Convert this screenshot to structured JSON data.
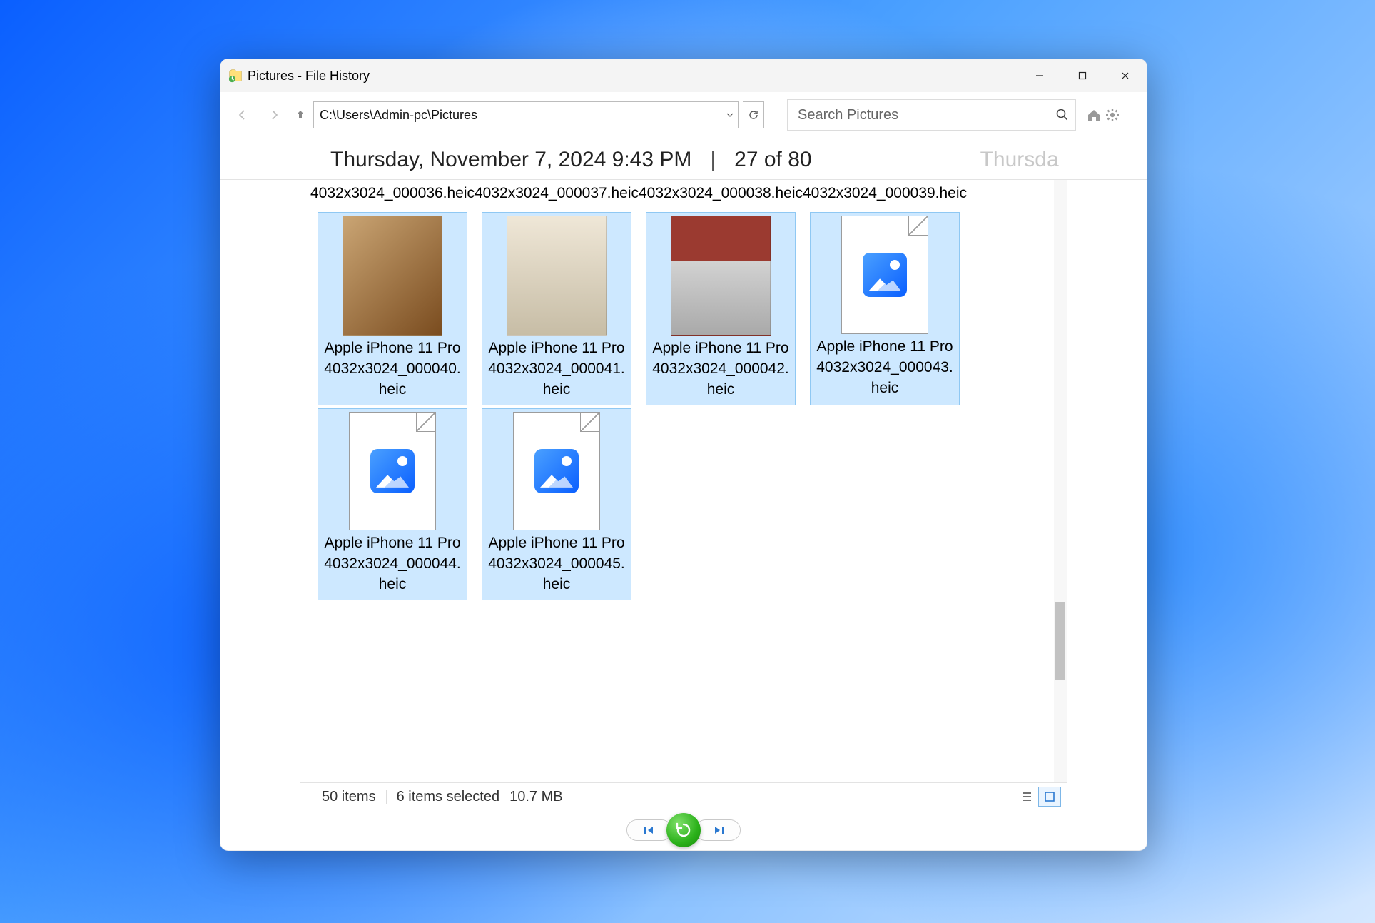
{
  "window": {
    "title": "Pictures - File History"
  },
  "nav": {
    "path": "C:\\Users\\Admin-pc\\Pictures",
    "search_placeholder": "Search Pictures"
  },
  "snapshot": {
    "datetime": "Thursday, November 7, 2024 9:43 PM",
    "index_label": "27 of 80",
    "next_preview": "Thursda"
  },
  "files": {
    "top_row_labels": [
      "4032x3024_000036.heic",
      "4032x3024_000037.heic",
      "4032x3024_000038.heic",
      "4032x3024_000039.heic"
    ],
    "tiles": [
      {
        "name": "Apple iPhone 11 Pro 4032x3024_000040.heic",
        "thumb": "photo40",
        "selected": true
      },
      {
        "name": "Apple iPhone 11 Pro 4032x3024_000041.heic",
        "thumb": "photo41",
        "selected": true
      },
      {
        "name": "Apple iPhone 11 Pro 4032x3024_000042.heic",
        "thumb": "photo42",
        "selected": true
      },
      {
        "name": "Apple iPhone 11 Pro 4032x3024_000043.heic",
        "thumb": "generic",
        "selected": true
      },
      {
        "name": "Apple iPhone 11 Pro 4032x3024_000044.heic",
        "thumb": "generic",
        "selected": true
      },
      {
        "name": "Apple iPhone 11 Pro 4032x3024_000045.heic",
        "thumb": "generic",
        "selected": true
      }
    ]
  },
  "status": {
    "item_count": "50 items",
    "selection": "6 items selected",
    "size": "10.7 MB"
  }
}
